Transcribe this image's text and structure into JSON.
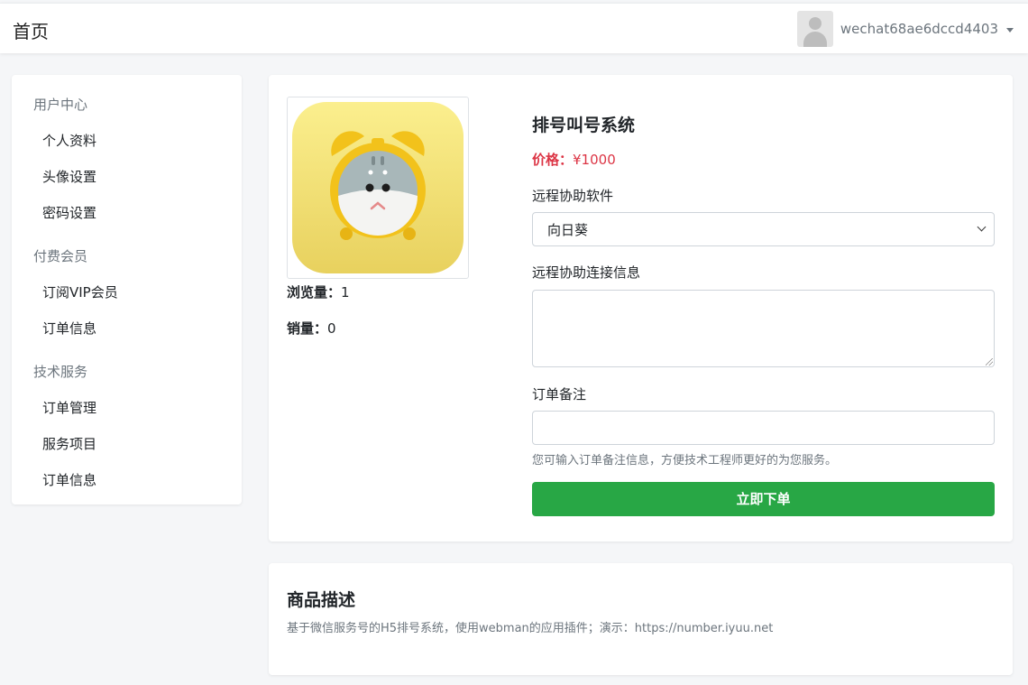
{
  "header": {
    "title": "首页",
    "username": "wechat68ae6dccd4403"
  },
  "sidebar": {
    "groups": [
      {
        "label": "用户中心",
        "items": [
          "个人资料",
          "头像设置",
          "密码设置"
        ]
      },
      {
        "label": "付费会员",
        "items": [
          "订阅VIP会员",
          "订单信息"
        ]
      },
      {
        "label": "技术服务",
        "items": [
          "订单管理",
          "服务项目",
          "订单信息"
        ]
      }
    ]
  },
  "product": {
    "image_icon": "alarm-clock-hamster-icon",
    "views_label": "浏览量：",
    "views_value": "1",
    "sales_label": "销量：",
    "sales_value": "0",
    "title": "排号叫号系统",
    "price_label": "价格：",
    "price_value": "¥1000",
    "remote_software_label": "远程协助软件",
    "remote_software_value": "向日葵",
    "remote_info_label": "远程协助连接信息",
    "remote_info_value": "",
    "remark_label": "订单备注",
    "remark_value": "",
    "remark_help": "您可输入订单备注信息，方便技术工程师更好的为您服务。",
    "submit_label": "立即下单"
  },
  "description": {
    "title": "商品描述",
    "text": "基于微信服务号的H5排号系统，使用webman的应用插件；演示：https://number.iyuu.net"
  },
  "colors": {
    "accent_green": "#28a745",
    "price_red": "#dc3545",
    "muted": "#6c757d",
    "page_bg": "#f5f6f8"
  }
}
